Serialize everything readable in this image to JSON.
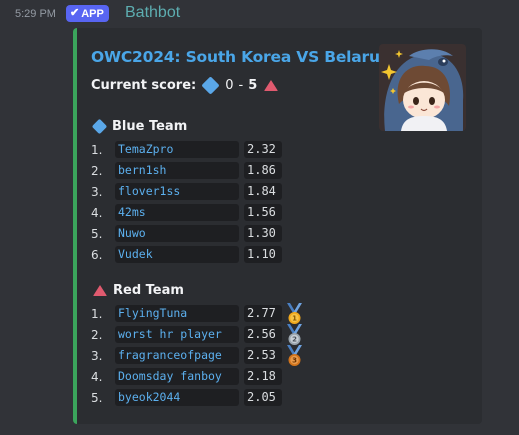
{
  "message": {
    "timestamp": "5:29 PM",
    "badge": "APP",
    "bot_name": "Bathbot"
  },
  "embed": {
    "accent_color": "#3ba55c",
    "title": "OWC2024: South Korea VS Belarus",
    "score_label": "Current score:",
    "blue_score": "0",
    "score_separator": "-",
    "red_score": "5",
    "thumbnail": "chibi-character-avatar",
    "blue_team": {
      "name": "Blue Team",
      "icon": "blue-diamond-icon",
      "color": "#5aa7e8",
      "players": [
        {
          "rank": "1.",
          "name": "TemaZpro",
          "value": "2.32"
        },
        {
          "rank": "2.",
          "name": "bern1sh",
          "value": "1.86"
        },
        {
          "rank": "3.",
          "name": "flover1ss",
          "value": "1.84"
        },
        {
          "rank": "4.",
          "name": "42ms",
          "value": "1.56"
        },
        {
          "rank": "5.",
          "name": "Nuwo",
          "value": "1.30"
        },
        {
          "rank": "6.",
          "name": "Vudek",
          "value": "1.10"
        }
      ]
    },
    "red_team": {
      "name": "Red Team",
      "icon": "red-triangle-icon",
      "color": "#e05a6f",
      "players": [
        {
          "rank": "1.",
          "name": "FlyingTuna",
          "value": "2.77",
          "medal": "gold-medal-icon"
        },
        {
          "rank": "2.",
          "name": "worst hr player",
          "value": "2.56",
          "medal": "silver-medal-icon"
        },
        {
          "rank": "3.",
          "name": "fragranceofpage",
          "value": "2.53",
          "medal": "bronze-medal-icon"
        },
        {
          "rank": "4.",
          "name": "Doomsday fanboy",
          "value": "2.18"
        },
        {
          "rank": "5.",
          "name": "byeok2044",
          "value": "2.05"
        }
      ]
    }
  }
}
